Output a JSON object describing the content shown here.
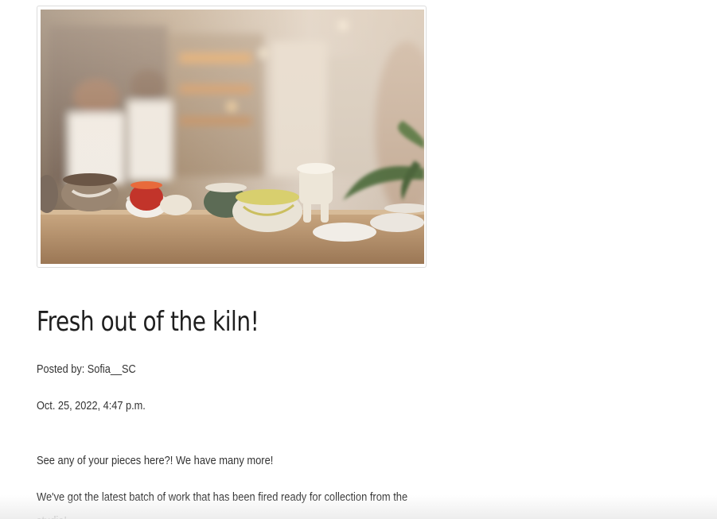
{
  "post": {
    "image_alt": "Ceramic pieces on a wooden table in a pottery studio",
    "title": "Fresh out of the kiln!",
    "author_line": "Posted by: Sofia__SC",
    "date": "Oct. 25, 2022, 4:47 p.m.",
    "paragraphs": [
      "See any of your pieces here?! We have many more!",
      "We've got the latest batch of work that has been fired ready for collection from the studio!"
    ]
  }
}
